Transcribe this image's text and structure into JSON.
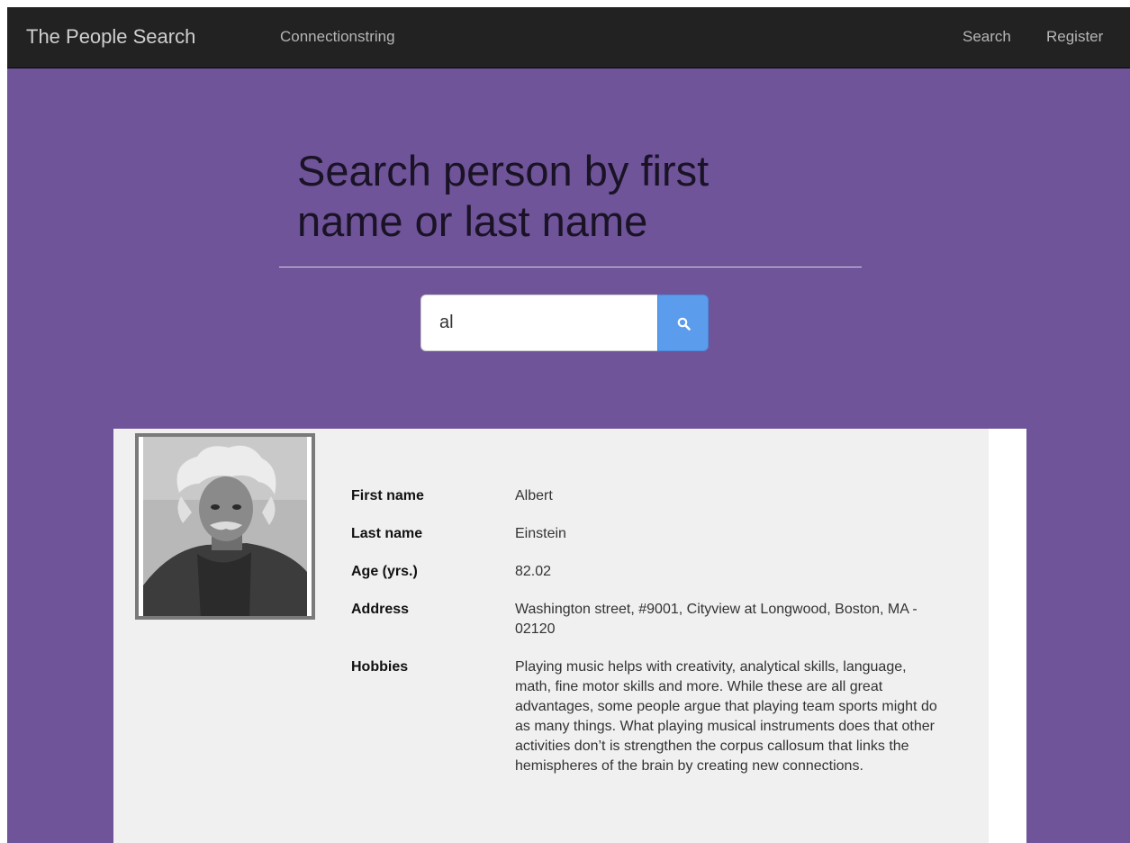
{
  "navbar": {
    "brand": "The People Search",
    "links": [
      "Connectionstring",
      "Search",
      "Register"
    ]
  },
  "main": {
    "title": "Search person by first name or last name",
    "search": {
      "value": "al",
      "button_icon": "search-icon"
    }
  },
  "result": {
    "photo_icon": "person-photo",
    "fields": [
      {
        "label": "First name",
        "value": "Albert"
      },
      {
        "label": "Last name",
        "value": "Einstein"
      },
      {
        "label": "Age (yrs.)",
        "value": "82.02"
      },
      {
        "label": "Address",
        "value": "Washington street, #9001, Cityview at Longwood, Boston, MA - 02120"
      },
      {
        "label": "Hobbies",
        "value": "Playing music helps with creativity, analytical skills, language, math, fine motor skills and more. While these are all great advantages, some people argue that playing team sports might do as many things. What playing musical instruments does that other activities don’t is strengthen the corpus callosum that links the hemispheres of the brain by creating new connections."
      }
    ]
  },
  "colors": {
    "navbar_bg": "#222222",
    "page_bg": "#6f5499",
    "search_button": "#5c9ced",
    "card_bg": "#f0f0f0"
  }
}
